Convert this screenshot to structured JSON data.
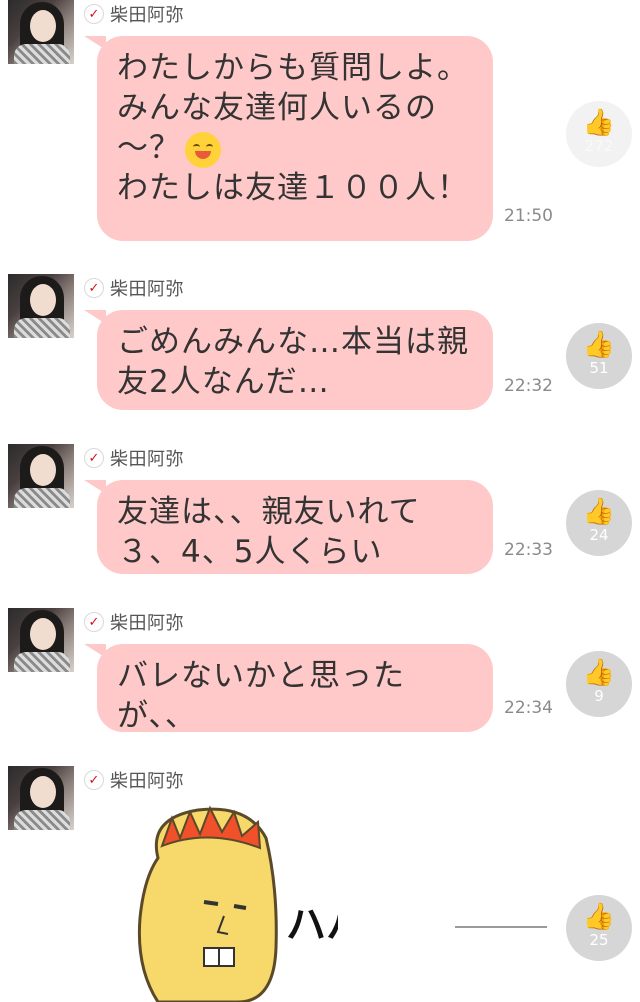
{
  "sender_name": "柴田阿弥",
  "messages": [
    {
      "text": "わたしからも質問しよ。\nみんな友達何人いるの\n〜？",
      "text2": "\nわたしは友達１００人！",
      "time": "21:50",
      "likes": "272"
    },
    {
      "text": "ごめんみんな…本当は親\n友2人なんだ…",
      "time": "22:32",
      "likes": "51"
    },
    {
      "text": "友達は、、親友いれて\n３、4、5人くらい",
      "time": "22:33",
      "likes": "24"
    },
    {
      "text": "バレないかと思った\nが、、",
      "time": "22:34",
      "likes": "9"
    },
    {
      "sticker": "sticker-character-haha",
      "sticker_text": "ハハ",
      "time": "",
      "likes": "25"
    }
  ],
  "icons": {
    "verified": "check-icon",
    "like": "thumb-icon",
    "emoji": "smile-emoji-icon"
  },
  "colors": {
    "bubble": "#ffc9c9",
    "like": "#d6d6d6",
    "check": "#d0121b"
  }
}
